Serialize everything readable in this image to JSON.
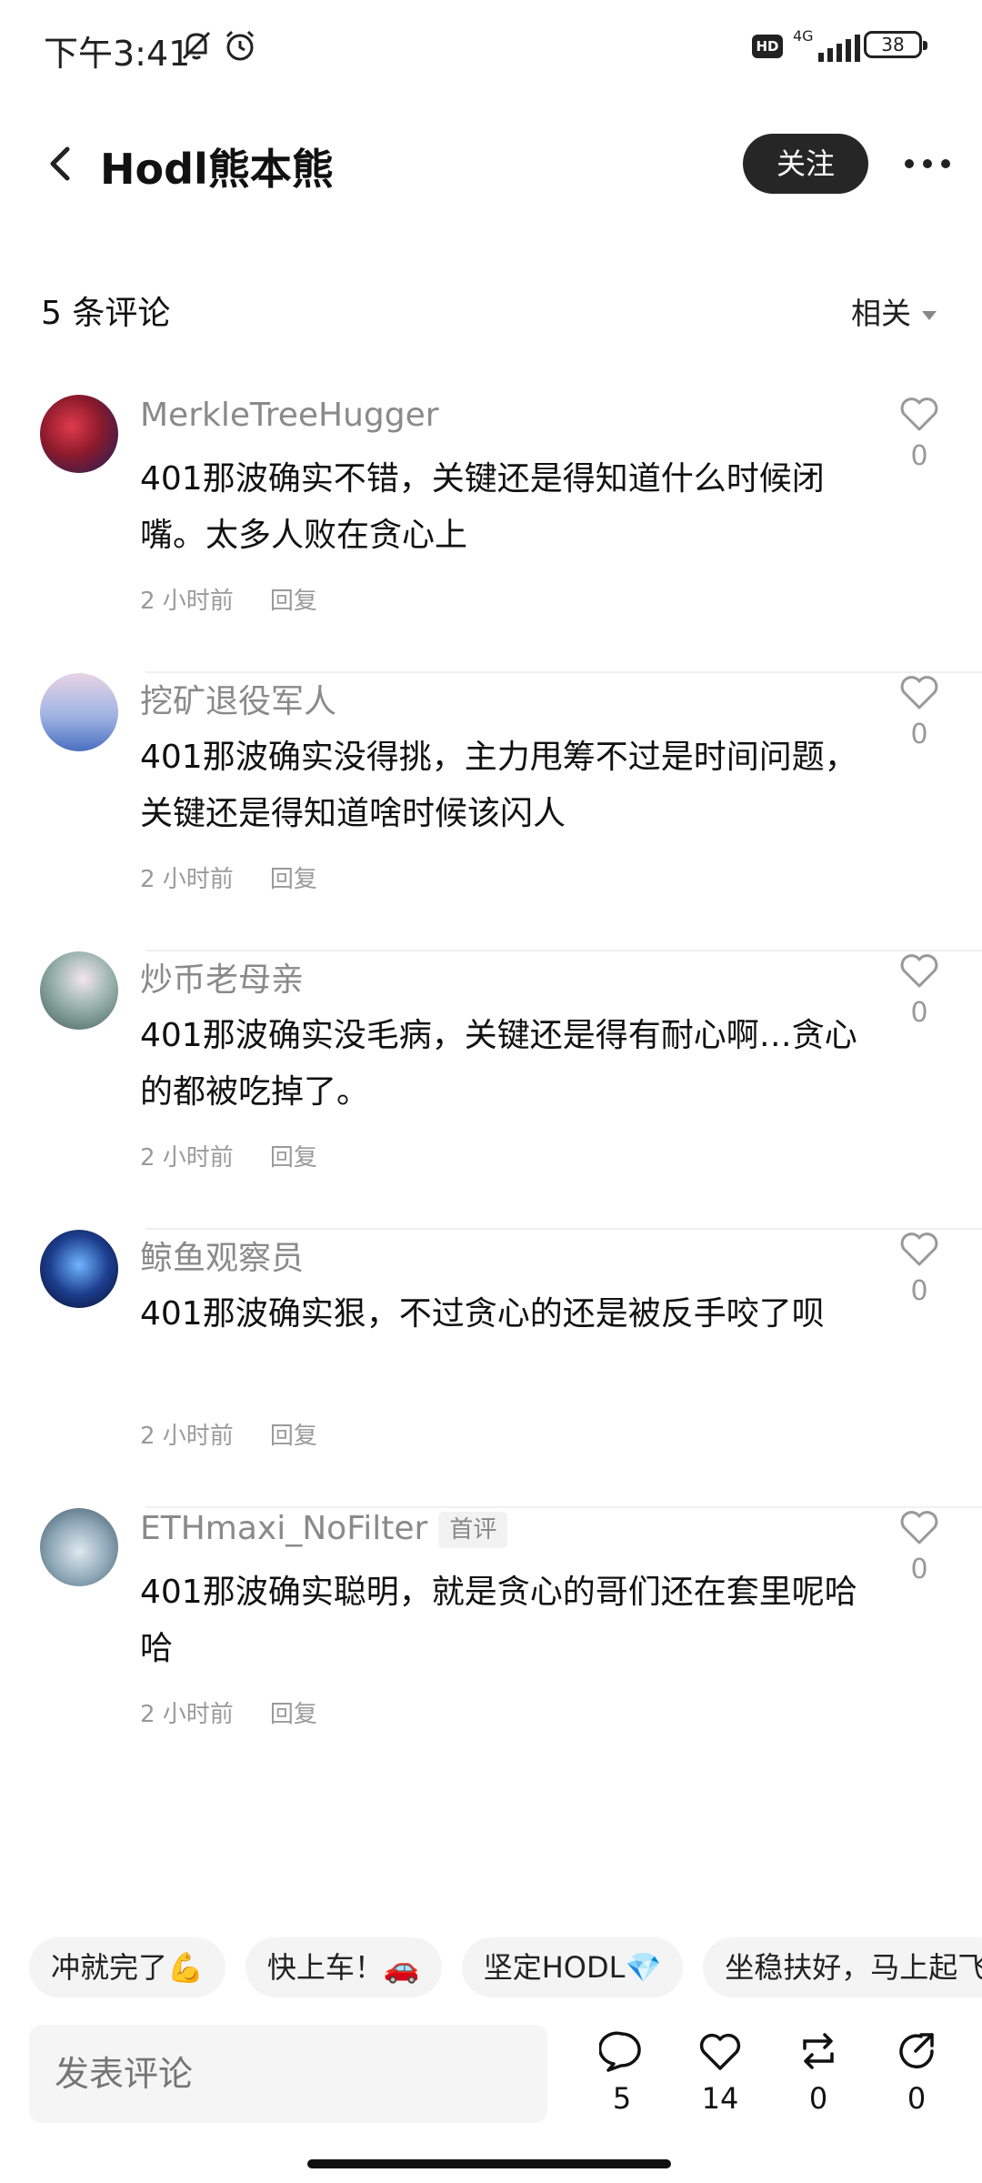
{
  "status_bar": {
    "time": "下午3:41",
    "hd": "HD",
    "network": "4G",
    "battery": "38"
  },
  "header": {
    "title": "Hodl熊本熊",
    "follow_label": "关注"
  },
  "comments_header": {
    "count_label": "5 条评论",
    "sort_label": "相关"
  },
  "comments": [
    {
      "user": "MerkleTreeHugger",
      "text": "401那波确实不错，关键还是得知道什么时候闭嘴。太多人败在贪心上",
      "time": "2 小时前",
      "reply": "回复",
      "likes": "0",
      "avatar_color": "#8b1a2b"
    },
    {
      "user": "挖矿退役军人",
      "text": "401那波确实没得挑，主力甩筹不过是时间问题，关键还是得知道啥时候该闪人",
      "time": "2 小时前",
      "reply": "回复",
      "likes": "0",
      "avatar_color": "#7ea6d8"
    },
    {
      "user": "炒币老母亲",
      "text": "401那波确实没毛病，关键还是得有耐心啊…贪心的都被吃掉了。",
      "time": "2 小时前",
      "reply": "回复",
      "likes": "0",
      "avatar_color": "#5f7f78"
    },
    {
      "user": "鲸鱼观察员",
      "text": "401那波确实狠，不过贪心的还是被反手咬了呗",
      "time": "2 小时前",
      "reply": "回复",
      "likes": "0",
      "avatar_color": "#1d3f8f"
    },
    {
      "user": "ETHmaxi_NoFilter",
      "tag": "首评",
      "text": "401那波确实聪明，就是贪心的哥们还在套里呢哈哈",
      "time": "2 小时前",
      "reply": "回复",
      "likes": "0",
      "avatar_color": "#8fa8b8"
    }
  ],
  "quick_replies": [
    "冲就完了💪",
    "快上车！🚗",
    "坚定HODL💎",
    "坐稳扶好，马上起飞"
  ],
  "bottom_bar": {
    "input_placeholder": "发表评论",
    "comment_count": "5",
    "like_count": "14",
    "repost_count": "0",
    "share_count": "0"
  },
  "icons": {
    "back": "chevron-left-icon",
    "more": "more-dots-icon",
    "like": "heart-icon",
    "comment": "comment-bubble-icon",
    "repost": "repost-icon",
    "share": "share-icon"
  }
}
